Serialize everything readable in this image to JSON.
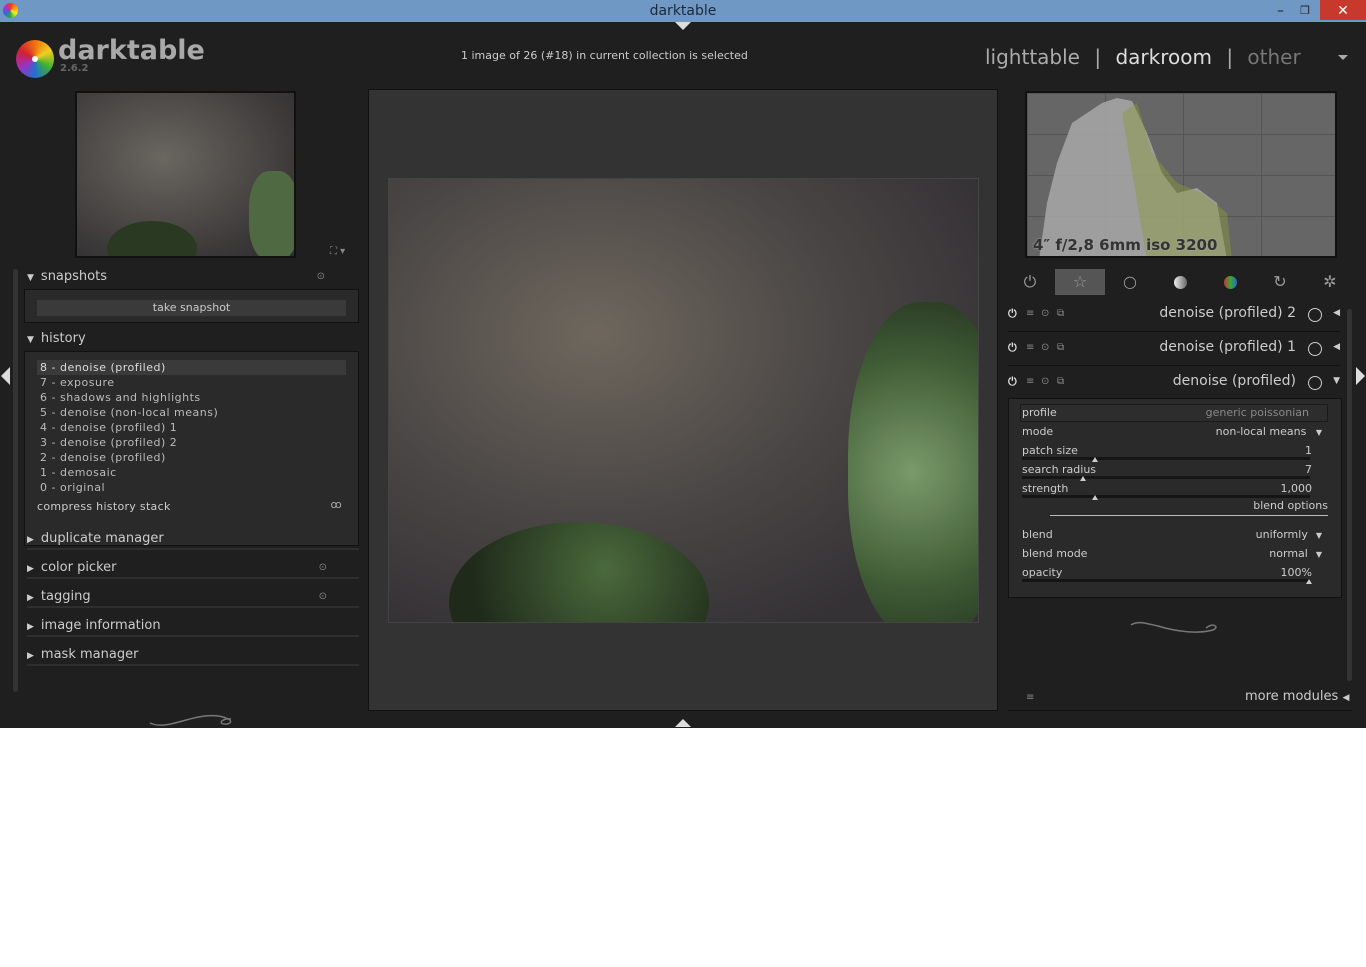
{
  "window": {
    "title": "darktable"
  },
  "app": {
    "name": "darktable",
    "version": "2.6.2"
  },
  "header": {
    "status": "1 image of 26 (#18) in current collection is selected",
    "views": [
      {
        "label": "lighttable"
      },
      {
        "label": "|"
      },
      {
        "label": "darkroom"
      },
      {
        "label": "|"
      },
      {
        "label": "other"
      }
    ]
  },
  "left": {
    "snapshots": {
      "label": "snapshots",
      "button": "take snapshot"
    },
    "history": {
      "label": "history",
      "items": [
        "8 - denoise (profiled)",
        "7 - exposure",
        "6 - shadows and highlights",
        "5 - denoise (non-local means)",
        "4 - denoise (profiled) 1",
        "3 - denoise (profiled) 2",
        "2 - denoise (profiled)",
        "1 - demosaic",
        "0 - original"
      ],
      "compress": "compress history stack"
    },
    "sections": [
      "duplicate manager",
      "color picker",
      "tagging",
      "image information",
      "mask manager"
    ]
  },
  "right": {
    "histogram_info": "4″ f/2,8 6mm iso 3200",
    "group_tabs": [
      "power-icon",
      "favorites-star-icon",
      "basic-circle-icon",
      "tone-sphere-icon",
      "color-sphere-icon",
      "correct-icon",
      "effect-icon"
    ],
    "modules": [
      {
        "name": "denoise (profiled) 2",
        "expanded": false
      },
      {
        "name": "denoise (profiled) 1",
        "expanded": false
      },
      {
        "name": "denoise (profiled)",
        "expanded": true
      }
    ],
    "params": {
      "profile": {
        "label": "profile",
        "value": "generic poissonian"
      },
      "mode": {
        "label": "mode",
        "value": "non-local means"
      },
      "patch_size": {
        "label": "patch size",
        "value": "1"
      },
      "search_radius": {
        "label": "search radius",
        "value": "7"
      },
      "strength": {
        "label": "strength",
        "value": "1,000"
      },
      "blend_options": "blend options",
      "blend": {
        "label": "blend",
        "value": "uniformly"
      },
      "blend_mode": {
        "label": "blend mode",
        "value": "normal"
      },
      "opacity": {
        "label": "opacity",
        "value": "100%"
      }
    },
    "more_modules": "more modules"
  },
  "colors": {
    "titlebar": "#6f98c4",
    "background": "#1f1f1f",
    "center": "#333333"
  }
}
